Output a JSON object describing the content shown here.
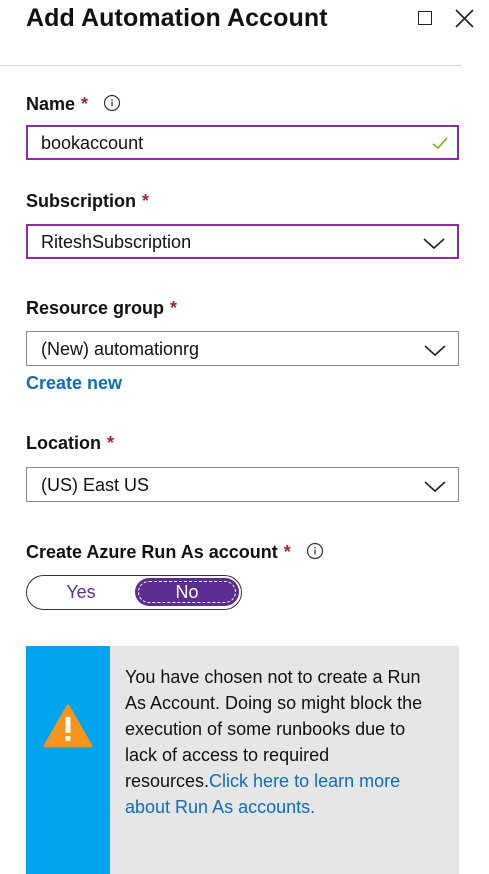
{
  "panel": {
    "title": "Add Automation Account"
  },
  "form": {
    "name": {
      "label": "Name",
      "required": "*",
      "value": "bookaccount"
    },
    "subscription": {
      "label": "Subscription",
      "required": "*",
      "value": "RiteshSubscription"
    },
    "resource_group": {
      "label": "Resource group",
      "required": "*",
      "value": "(New) automationrg",
      "create_new": "Create new"
    },
    "location": {
      "label": "Location",
      "required": "*",
      "value": "(US) East US"
    },
    "run_as": {
      "label": "Create Azure Run As account",
      "required": "*",
      "yes": "Yes",
      "no": "No",
      "selected": "No"
    }
  },
  "warning": {
    "text": "You have chosen not to create a Run As Account. Doing so might block the execution of some runbooks due to lack of access to required resources.",
    "link": "Click here to learn more about Run As accounts.",
    "icon": "warning-triangle-icon"
  },
  "colors": {
    "accent_purple": "#5c2d91",
    "focus_border": "#8a2da5",
    "link_blue": "#0f6cbd",
    "info_stripe": "#00a4ef",
    "warning_orange": "#f7941d",
    "required_red": "#a4262c",
    "valid_green": "#6bb700"
  }
}
